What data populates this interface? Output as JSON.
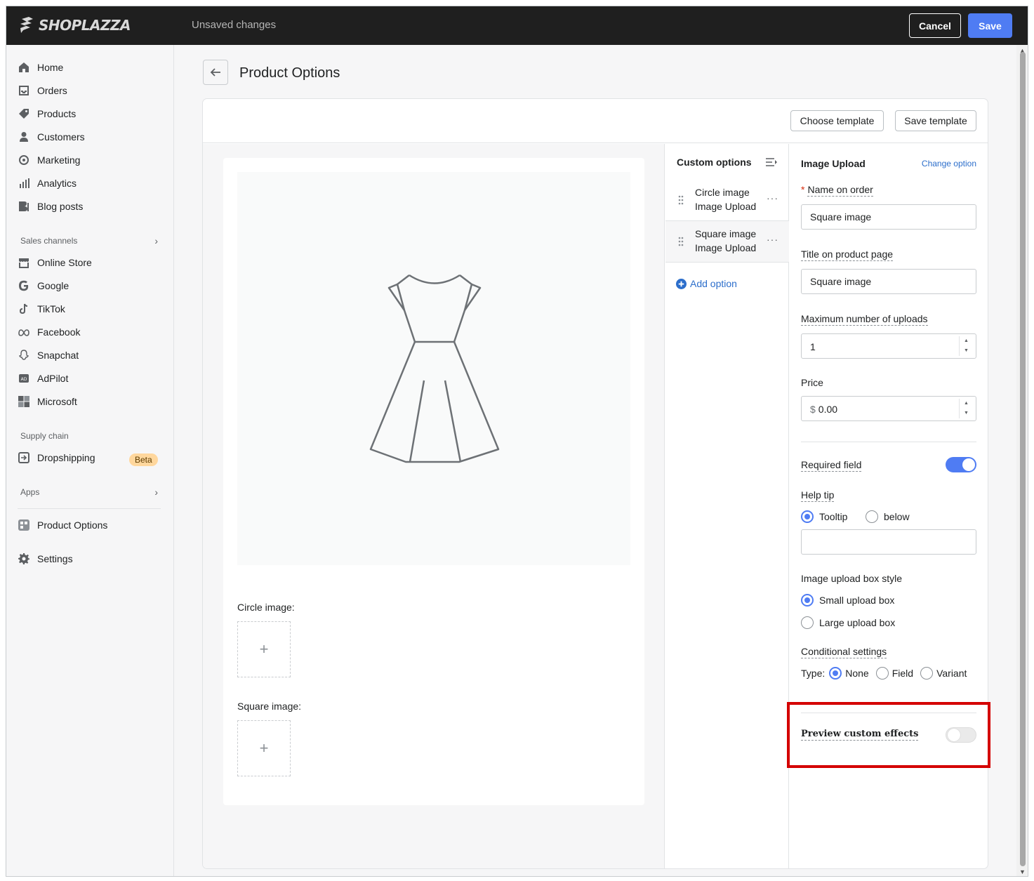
{
  "topbar": {
    "logo_text": "SHOPLAZZA",
    "status": "Unsaved changes",
    "cancel_label": "Cancel",
    "save_label": "Save"
  },
  "sidebar": {
    "main_items": [
      {
        "label": "Home",
        "icon": "home-icon"
      },
      {
        "label": "Orders",
        "icon": "inbox-icon"
      },
      {
        "label": "Products",
        "icon": "tag-icon"
      },
      {
        "label": "Customers",
        "icon": "person-icon"
      },
      {
        "label": "Marketing",
        "icon": "target-icon"
      },
      {
        "label": "Analytics",
        "icon": "bar-chart-icon"
      },
      {
        "label": "Blog posts",
        "icon": "blog-icon"
      }
    ],
    "sales_channels_label": "Sales channels",
    "channels": [
      {
        "label": "Online Store",
        "icon": "store-icon"
      },
      {
        "label": "Google",
        "icon": "google-icon"
      },
      {
        "label": "TikTok",
        "icon": "tiktok-icon"
      },
      {
        "label": "Facebook",
        "icon": "meta-icon"
      },
      {
        "label": "Snapchat",
        "icon": "snapchat-icon"
      },
      {
        "label": "AdPilot",
        "icon": "ad-icon"
      },
      {
        "label": "Microsoft",
        "icon": "microsoft-icon"
      }
    ],
    "supply_chain_label": "Supply chain",
    "dropshipping_label": "Dropshipping",
    "beta_label": "Beta",
    "apps_label": "Apps",
    "product_options_label": "Product Options",
    "settings_label": "Settings"
  },
  "page": {
    "title": "Product Options",
    "choose_template_label": "Choose template",
    "save_template_label": "Save template"
  },
  "preview": {
    "upload_labels": [
      "Circle image:",
      "Square image:"
    ],
    "plus": "+"
  },
  "custom_options": {
    "heading": "Custom options",
    "items": [
      {
        "name": "Circle image",
        "type": "Image Upload"
      },
      {
        "name": "Square image",
        "type": "Image Upload"
      }
    ],
    "more": "···",
    "add_label": "Add option"
  },
  "settings": {
    "title": "Image Upload",
    "change_option": "Change option",
    "name_on_order_label": "Name on order",
    "name_on_order_value": "Square image",
    "title_on_page_label": "Title on product page",
    "title_on_page_value": "Square image",
    "max_uploads_label": "Maximum number of uploads",
    "max_uploads_value": "1",
    "price_label": "Price",
    "price_prefix": "$",
    "price_value": "0.00",
    "required_label": "Required field",
    "required_on": true,
    "help_tip_label": "Help tip",
    "help_tip_options": [
      "Tooltip",
      "below"
    ],
    "help_tip_value": "",
    "box_style_label": "Image upload box style",
    "box_style_options": [
      "Small upload box",
      "Large upload box"
    ],
    "conditional_label": "Conditional settings",
    "type_label": "Type:",
    "type_options": [
      "None",
      "Field",
      "Variant"
    ],
    "preview_effects_label": "Preview custom effects",
    "preview_effects_on": false
  },
  "colors": {
    "accent": "#4f7cf3",
    "highlight": "#d40000",
    "topbar": "#1f1f1f"
  }
}
